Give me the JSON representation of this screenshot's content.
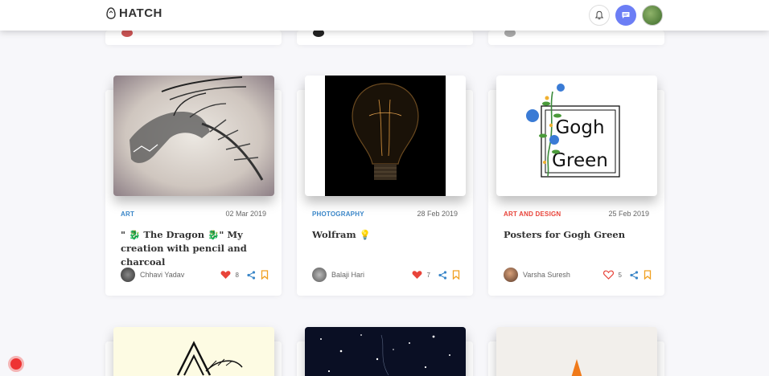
{
  "header": {
    "brand": "HATCH"
  },
  "cards": [
    {
      "category": "ART",
      "category_color": "#3a86c8",
      "date": "02 Mar 2019",
      "title": "\" 🐉 The Dragon 🐉\" My creation with pencil and charcoal",
      "author": "Chhavi Yadav",
      "likes": "8",
      "liked": true
    },
    {
      "category": "PHOTOGRAPHY",
      "category_color": "#3a86c8",
      "date": "28 Feb 2019",
      "title": "Wolfram 💡",
      "author": "Balaji Hari",
      "likes": "7",
      "liked": true
    },
    {
      "category": "ART AND DESIGN",
      "category_color": "#e8443a",
      "date": "25 Feb 2019",
      "title": "Posters for Gogh Green",
      "author": "Varsha Suresh",
      "likes": "5",
      "liked": false
    }
  ],
  "poster_text": [
    "Gogh",
    "Green"
  ],
  "colors": {
    "accent": "#6c7ef5",
    "like": "#e8443a",
    "share": "#3a86c8",
    "bookmark": "#f0a020"
  },
  "icons": [
    "bell-icon",
    "message-icon",
    "heart-icon",
    "share-icon",
    "bookmark-icon"
  ]
}
